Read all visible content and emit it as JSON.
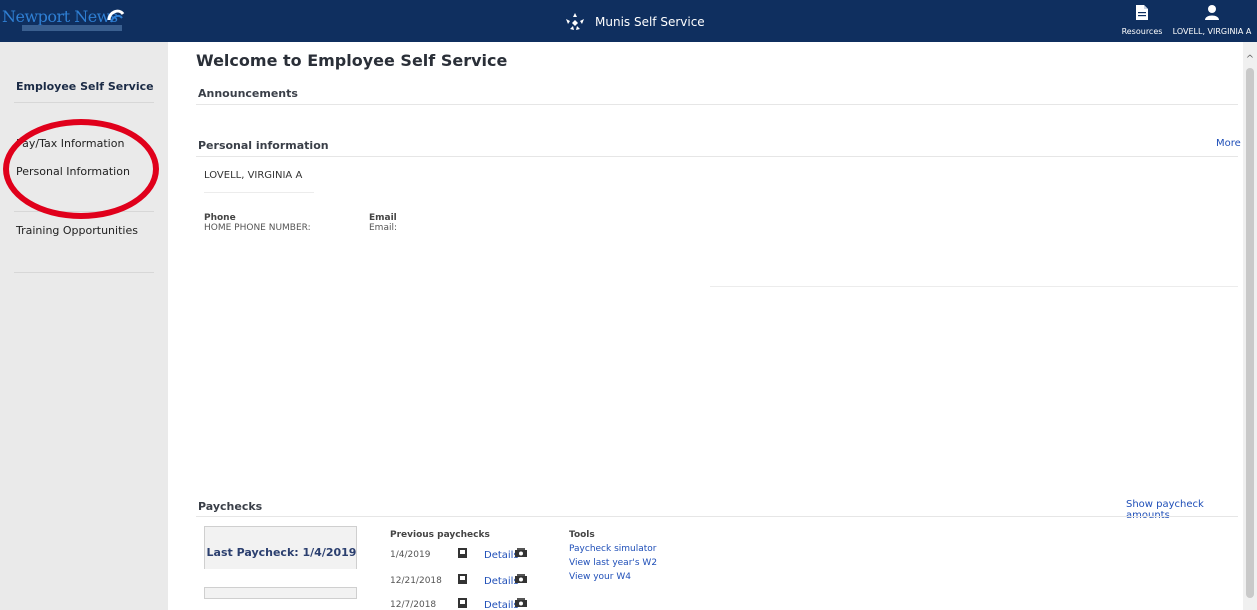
{
  "header": {
    "logo_text": "Newport News",
    "app_title": "Munis Self Service",
    "resources_label": "Resources",
    "user_label": "LOVELL, VIRGINIA A"
  },
  "sidebar": {
    "title": "Employee Self Service",
    "items": [
      {
        "label": "Pay/Tax Information"
      },
      {
        "label": "Personal Information"
      },
      {
        "label": "Training Opportunities"
      }
    ]
  },
  "main": {
    "welcome": "Welcome to Employee Self Service",
    "announcements_title": "Announcements",
    "personal": {
      "title": "Personal information",
      "more_link": "More",
      "name": "LOVELL, VIRGINIA A",
      "phone_label": "Phone",
      "phone_value": "HOME PHONE NUMBER: ",
      "email_label": "Email",
      "email_value": "Email:"
    },
    "paychecks": {
      "title": "Paychecks",
      "show_amounts_link": "Show paycheck amounts",
      "last_paycheck": "Last Paycheck: 1/4/2019",
      "previous_title": "Previous paychecks",
      "previous": [
        {
          "date": "1/4/2019",
          "details": "Details"
        },
        {
          "date": "12/21/2018",
          "details": "Details"
        },
        {
          "date": "12/7/2018",
          "details": "Details"
        }
      ],
      "tools_title": "Tools",
      "tools": [
        {
          "label": "Paycheck simulator"
        },
        {
          "label": "View last year's W2"
        },
        {
          "label": "View your W4"
        }
      ]
    }
  },
  "annotation_color": "#e0001b"
}
